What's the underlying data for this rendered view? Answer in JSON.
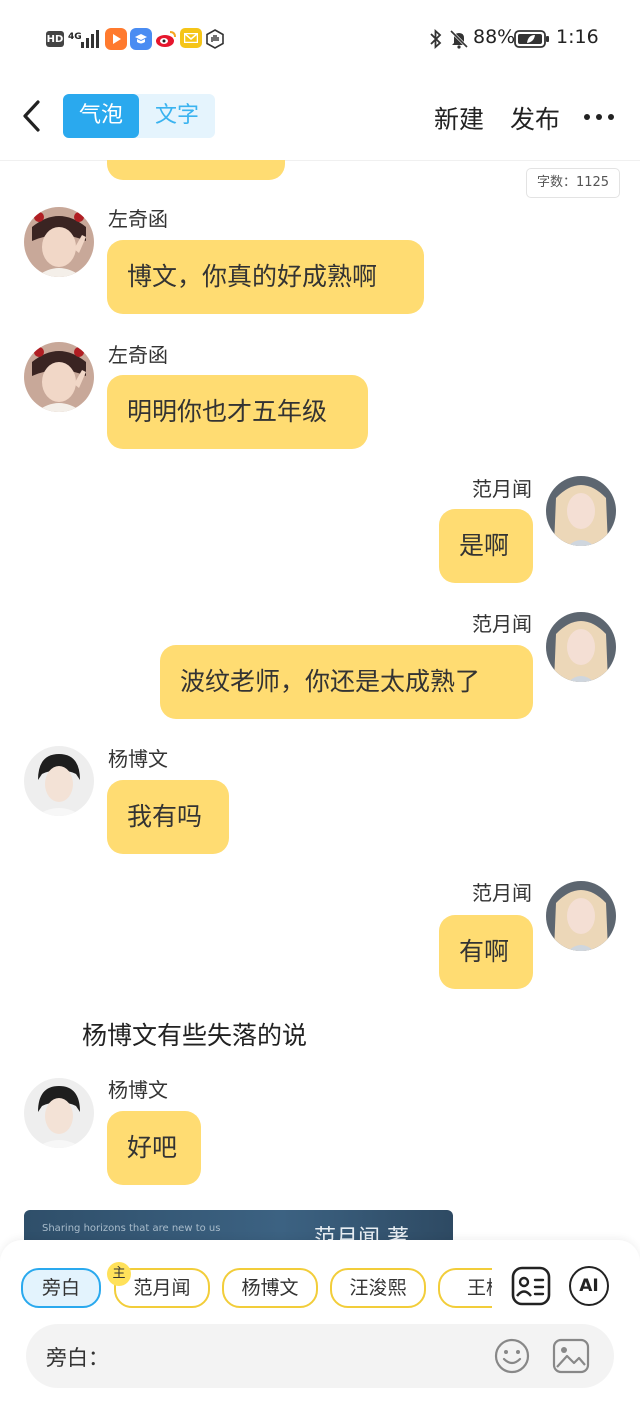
{
  "status_bar": {
    "hd": "HD",
    "net": "4G",
    "battery": "88%",
    "time": "1:16",
    "icons": [
      "signal-icon",
      "video-app-icon",
      "learning-app-icon",
      "weibo-icon",
      "mail-icon",
      "hand-icon",
      "bluetooth-icon",
      "bell-mute-icon",
      "battery-icon"
    ]
  },
  "header": {
    "tab_bubble": "气泡",
    "tab_text": "文字",
    "new_label": "新建",
    "publish_label": "发布"
  },
  "word_count": "字数：1125",
  "messages": [
    {
      "sender": "左奇函",
      "text": "博文，你真的好成熟啊",
      "side": "left"
    },
    {
      "sender": "左奇函",
      "text": "明明你也才五年级",
      "side": "left"
    },
    {
      "sender": "范月闻",
      "text": "是啊",
      "side": "right"
    },
    {
      "sender": "范月闻",
      "text": "波纹老师，你还是太成熟了",
      "side": "right"
    },
    {
      "sender": "杨博文",
      "text": "我有吗",
      "side": "left"
    },
    {
      "sender": "范月闻",
      "text": "有啊",
      "side": "right"
    },
    {
      "sender": "杨博文",
      "text": "好吧",
      "side": "left"
    }
  ],
  "narration": "杨博文有些失落的说",
  "banner": {
    "small": "Sharing horizons that are new to us",
    "title": "范月闻 著"
  },
  "characters": {
    "chips": [
      "旁白",
      "范月闻",
      "杨博文",
      "汪浚熙",
      "王櫓"
    ],
    "selected": "旁白",
    "main_tag": "主"
  },
  "input": {
    "label": "旁白："
  },
  "toolbar": {
    "ai_label": "AI"
  },
  "colors": {
    "accent": "#2aa9ee",
    "bubble": "#ffdc72",
    "chip_border": "#f2cd3a"
  }
}
